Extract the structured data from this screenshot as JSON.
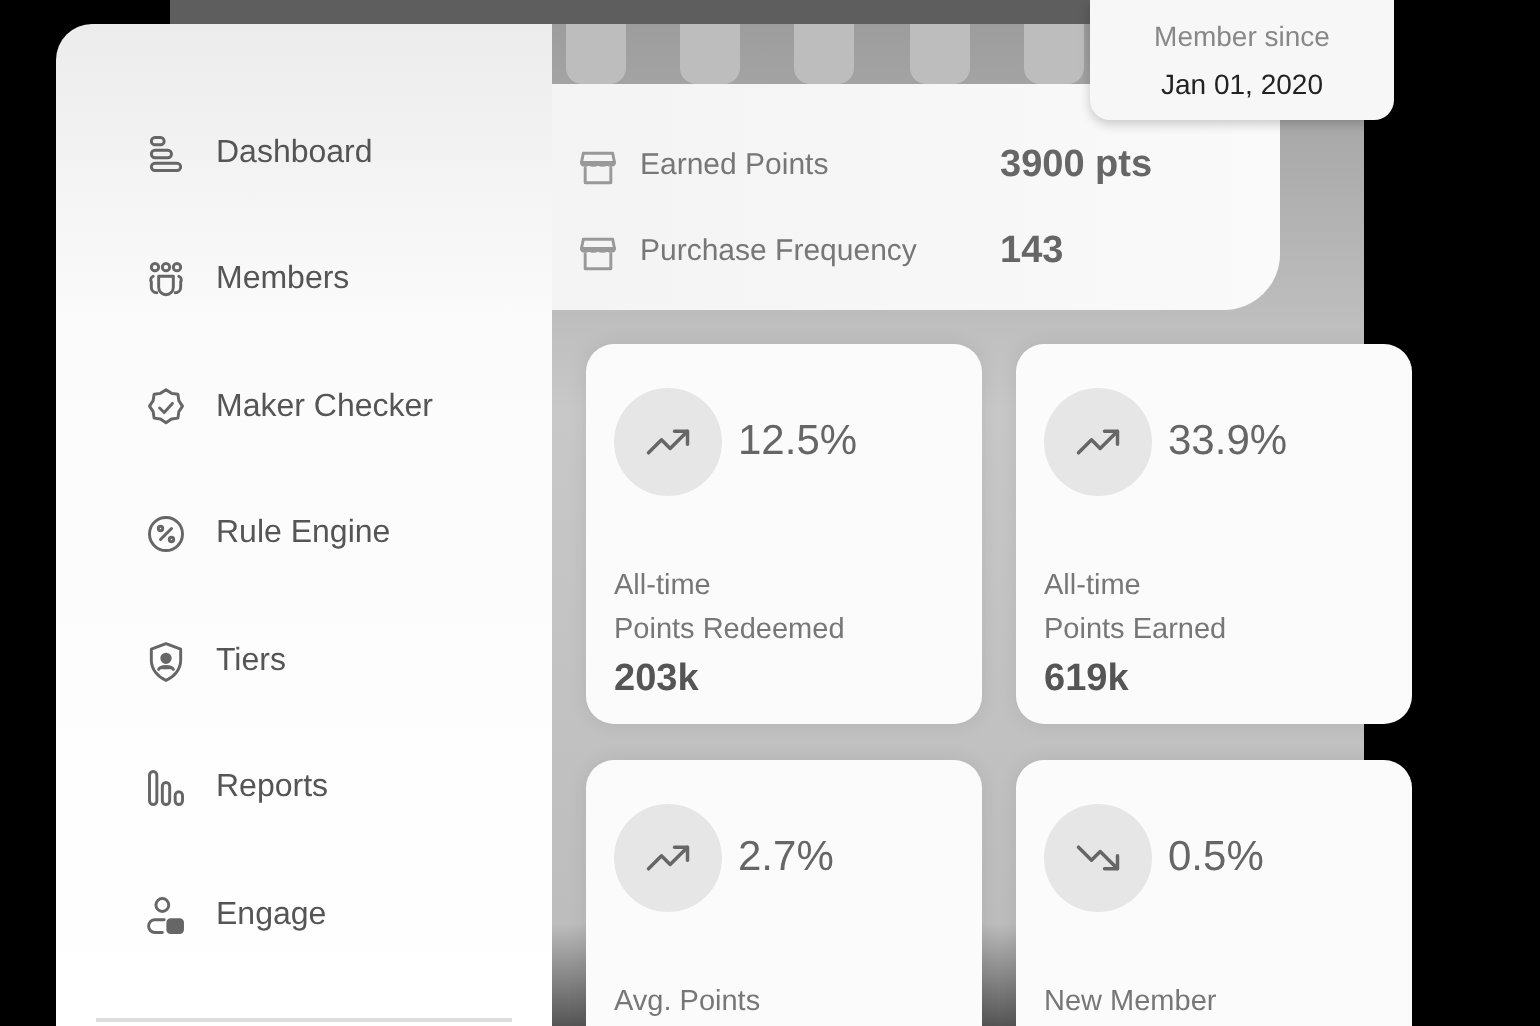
{
  "sidebar": {
    "items": [
      {
        "label": "Dashboard"
      },
      {
        "label": "Members"
      },
      {
        "label": "Maker Checker"
      },
      {
        "label": "Rule Engine"
      },
      {
        "label": "Tiers"
      },
      {
        "label": "Reports"
      },
      {
        "label": "Engage"
      }
    ]
  },
  "member_card": {
    "caption": "Member since",
    "date": "Jan 01, 2020"
  },
  "summary": {
    "rows": [
      {
        "label": "Earned Points",
        "value": "3900 pts"
      },
      {
        "label": "Purchase Frequency",
        "value": "143"
      }
    ]
  },
  "stats": [
    {
      "kind": "up",
      "change": "12.5%",
      "label_lines": [
        "All-time",
        "Points Redeemed"
      ],
      "value": "203k"
    },
    {
      "kind": "up",
      "change": "33.9%",
      "label_lines": [
        "All-time",
        "Points Earned"
      ],
      "value": "619k"
    },
    {
      "kind": "up",
      "change": "2.7%",
      "label_lines": [
        "Avg. Points"
      ]
    },
    {
      "kind": "down",
      "change": "0.5%",
      "label_lines": [
        "New Member"
      ]
    }
  ]
}
